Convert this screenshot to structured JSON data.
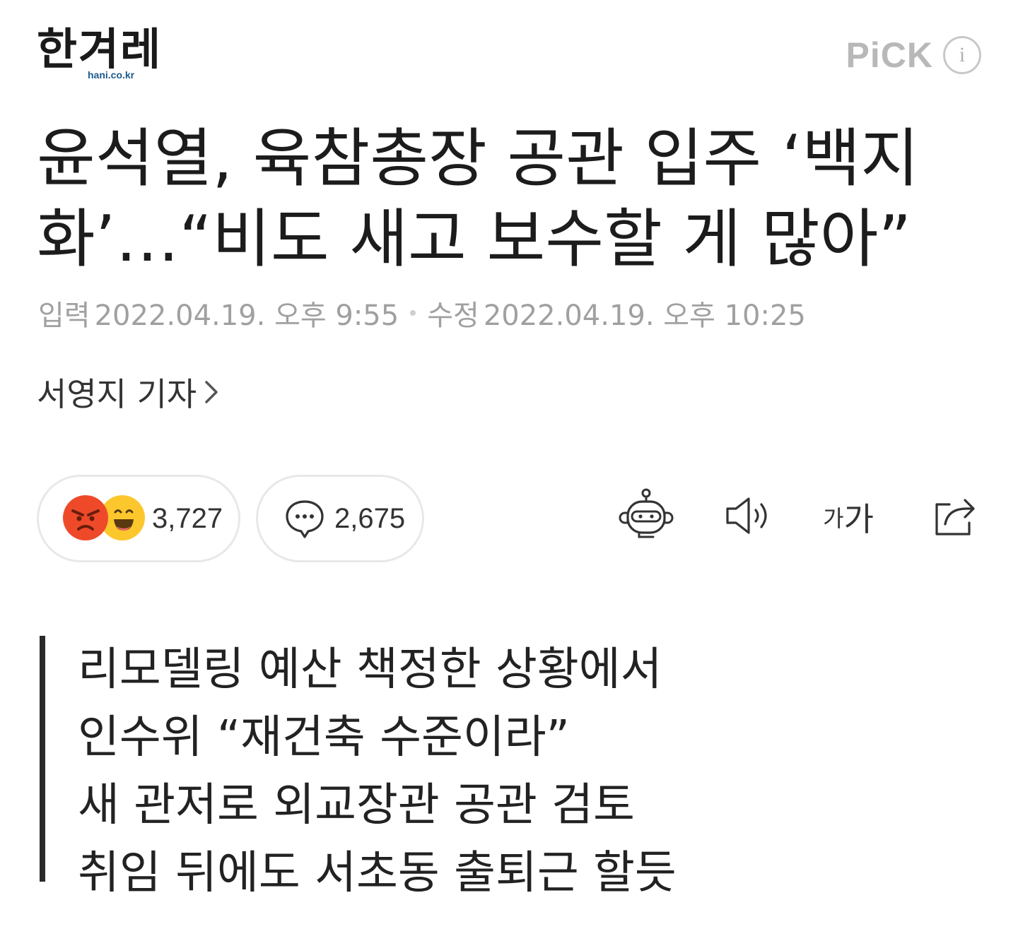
{
  "header": {
    "logo_text": "한겨레",
    "logo_sub": "hani.co.kr",
    "pick_label": "PiCK",
    "info_label": "i"
  },
  "article": {
    "title_line1": "윤석열, 육참총장 공관 입주 ‘백지",
    "title_line2": "화’…“비도 새고 보수할 게 많아”",
    "published_label": "입력",
    "published_at": "2022.04.19. 오후 9:55",
    "modified_label": "수정",
    "modified_at": "2022.04.19. 오후 10:25",
    "reporter": "서영지 기자"
  },
  "actions": {
    "reactions_count": "3,727",
    "comments_count": "2,675",
    "font_small": "가",
    "font_large": "가"
  },
  "summary": {
    "lines": [
      "리모델링 예산 책정한 상황에서",
      "인수위 “재건축 수준이라”",
      "새 관저로 외교장관 공관 검토",
      "취임 뒤에도 서초동 출퇴근 할듯"
    ]
  },
  "colors": {
    "angry_face": "#ee4a2a",
    "laugh_face": "#fcc72c",
    "meta_text": "#a0a0a0",
    "pick_text": "#b8b8b8"
  }
}
